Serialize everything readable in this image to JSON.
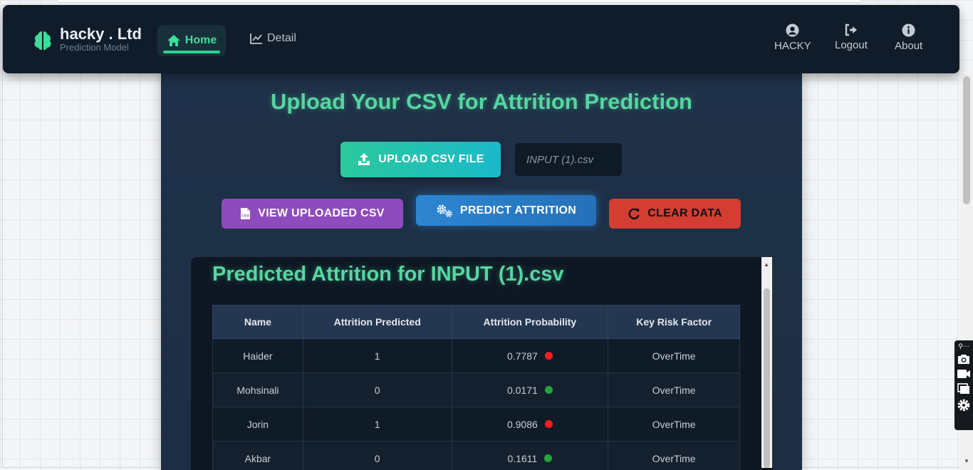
{
  "navbar": {
    "brand_title": "hacky . Ltd",
    "brand_subtitle": "Prediction Model",
    "home_label": "Home",
    "detail_label": "Detail",
    "user_label": "HACKY",
    "logout_label": "Logout",
    "about_label": "About"
  },
  "main": {
    "title": "Upload Your CSV for Attrition Prediction",
    "upload_button": "UPLOAD CSV FILE",
    "file_name": "INPUT (1).csv",
    "view_button": "VIEW UPLOADED CSV",
    "predict_button": "PREDICT ATTRITION",
    "clear_button": "CLEAR DATA"
  },
  "results": {
    "title": "Predicted Attrition for INPUT (1).csv",
    "columns": [
      "Name",
      "Attrition Predicted",
      "Attrition Probability",
      "Key Risk Factor"
    ],
    "rows": [
      {
        "name": "Haider",
        "predicted": "1",
        "probability": "0.7787",
        "risk": "OverTime",
        "status": "red"
      },
      {
        "name": "Mohsinali",
        "predicted": "0",
        "probability": "0.0171",
        "risk": "OverTime",
        "status": "green"
      },
      {
        "name": "Jorin",
        "predicted": "1",
        "probability": "0.9086",
        "risk": "OverTime",
        "status": "red"
      },
      {
        "name": "Akbar",
        "predicted": "0",
        "probability": "0.1611",
        "risk": "OverTime",
        "status": "green"
      }
    ]
  },
  "colors": {
    "accent_green": "#55d6a0",
    "navbar_bg": "#111c2a",
    "high_risk": "#ff1d1d",
    "low_risk": "#22a43a"
  },
  "icons": {
    "brand": "brain-icon",
    "home": "home-icon",
    "detail": "chart-line-icon",
    "user": "user-circle-icon",
    "logout": "logout-icon",
    "about": "info-icon",
    "upload": "upload-icon",
    "view": "csv-file-icon",
    "predict": "gears-icon",
    "clear": "refresh-icon"
  }
}
